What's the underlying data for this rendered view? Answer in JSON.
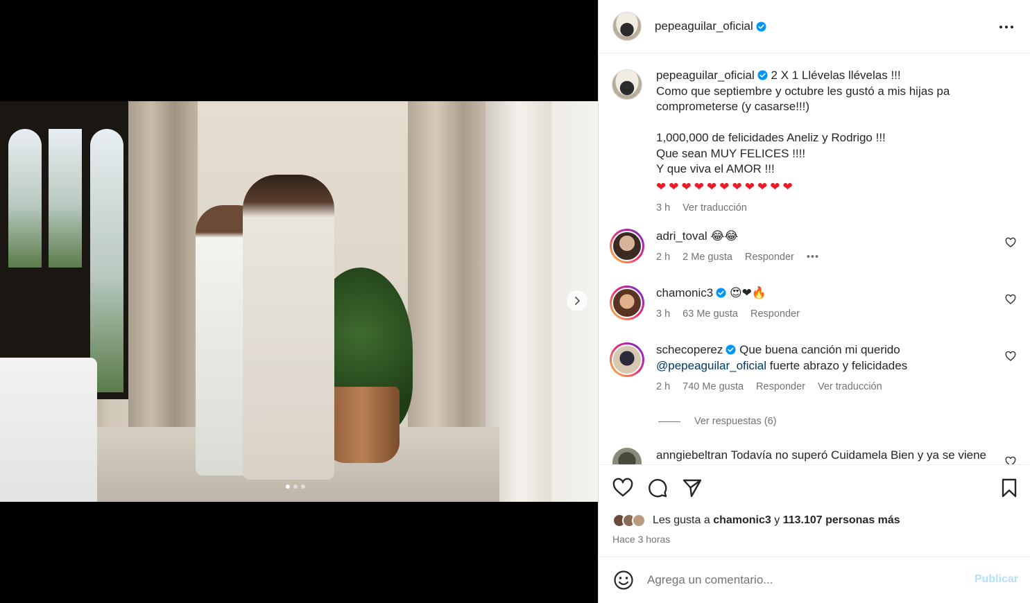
{
  "post": {
    "username": "pepeaguilar_oficial",
    "caption_first": "2 X 1 Llévelas llévelas !!!",
    "caption_lines": [
      "Como que septiembre y octubre les gustó a mis hijas pa",
      "comprometerse (y casarse!!!)",
      "",
      "1,000,000 de felicidades Aneliz y Rodrigo !!!",
      "Que sean MUY FELICES !!!!",
      "Y que viva el AMOR !!!"
    ],
    "caption_hearts": "❤❤❤❤❤❤❤❤❤❤❤",
    "caption_time": "3 h",
    "caption_translate": "Ver traducción"
  },
  "comments": [
    {
      "user": "adri_toval",
      "text": "😂😂",
      "time": "2 h",
      "likes": "2 Me gusta",
      "reply": "Responder",
      "more": "•••"
    },
    {
      "user": "chamonic3",
      "text": "😍❤🔥",
      "time": "3 h",
      "likes": "63 Me gusta",
      "reply": "Responder"
    },
    {
      "user": "schecoperez",
      "text": "Que buena canción mi querido",
      "mention": "@pepeaguilar_oficial",
      "text2": "fuerte abrazo y felicidades",
      "time": "2 h",
      "likes": "740 Me gusta",
      "reply": "Responder",
      "translate": "Ver traducción"
    },
    {
      "user": "anngiebeltran",
      "text": "Todavía no superó Cuidamela Bien y ya se viene"
    }
  ],
  "view_replies": "Ver respuestas (6)",
  "likes_bar": {
    "prefix": "Les gusta a",
    "user": "chamonic3",
    "conj": "y",
    "rest": "113.107 personas más"
  },
  "posted": "Hace 3 horas",
  "add_comment": {
    "placeholder": "Agrega un comentario...",
    "publish": "Publicar"
  },
  "media": {
    "slide_count": 3,
    "active_slide": 1
  },
  "colors": {
    "verified": "#0095f6",
    "link": "#00376b",
    "heart": "#ed1c24",
    "publish_disabled": "#b2dffc"
  }
}
